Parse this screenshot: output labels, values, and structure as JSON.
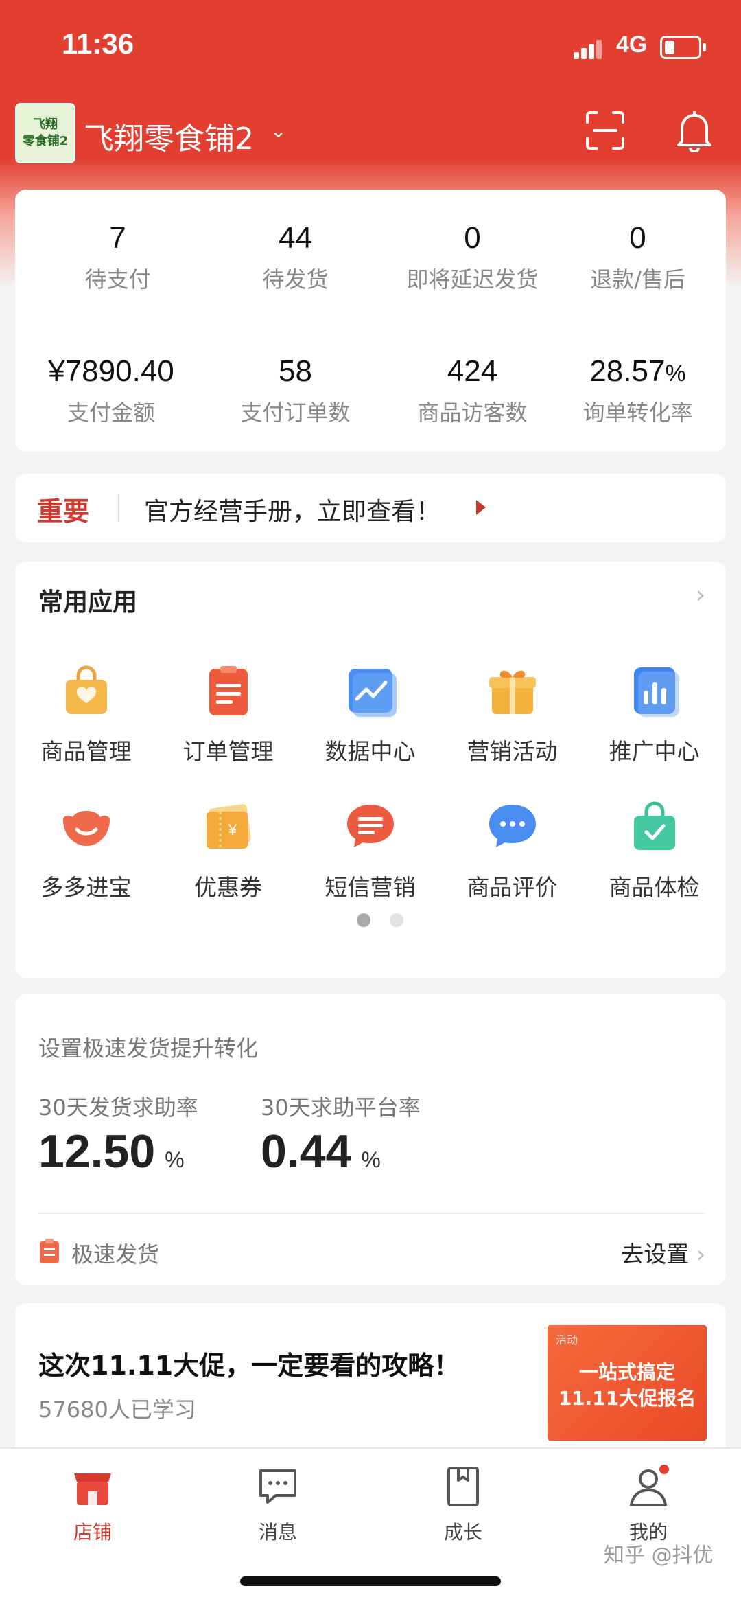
{
  "status_bar": {
    "time": "11:36",
    "network": "4G"
  },
  "shop": {
    "logo_text": "飞翔\n零食铺2",
    "name": "飞翔零食铺2"
  },
  "stats_top": [
    {
      "value": "7",
      "label": "待支付"
    },
    {
      "value": "44",
      "label": "待发货"
    },
    {
      "value": "0",
      "label": "即将延迟发货"
    },
    {
      "value": "0",
      "label": "退款/售后"
    }
  ],
  "stats_bottom": [
    {
      "value": "¥7890.40",
      "label": "支付金额"
    },
    {
      "value": "58",
      "label": "支付订单数"
    },
    {
      "value": "424",
      "label": "商品访客数"
    },
    {
      "value": "28.57",
      "unit": "%",
      "label": "询单转化率"
    }
  ],
  "notice": {
    "tag": "重要",
    "text": "官方经营手册，立即查看！"
  },
  "apps": {
    "title": "常用应用",
    "items": [
      {
        "label": "商品管理",
        "icon": "shopping-bag-icon"
      },
      {
        "label": "订单管理",
        "icon": "clipboard-icon"
      },
      {
        "label": "数据中心",
        "icon": "chart-line-icon"
      },
      {
        "label": "营销活动",
        "icon": "gift-box-icon"
      },
      {
        "label": "推广中心",
        "icon": "bar-chart-icon"
      },
      {
        "label": "多多进宝",
        "icon": "ingot-icon"
      },
      {
        "label": "优惠券",
        "icon": "coupon-icon"
      },
      {
        "label": "短信营销",
        "icon": "sms-icon"
      },
      {
        "label": "商品评价",
        "icon": "comment-icon"
      },
      {
        "label": "商品体检",
        "icon": "check-bag-icon"
      }
    ]
  },
  "shipping": {
    "title": "设置极速发货提升转化",
    "metric1_label": "30天发货求助率",
    "metric1_value": "12.50",
    "metric2_label": "30天求助平台率",
    "metric2_value": "0.44",
    "unit": "%",
    "fast_label": "极速发货",
    "go_label": "去设置"
  },
  "promo": {
    "title": "这次11.11大促，一定要看的攻略！",
    "subtitle": "57680人已学习",
    "banner_tag": "活动",
    "banner_line1": "一站式搞定",
    "banner_line2": "11.11大促报名"
  },
  "tabs": [
    {
      "label": "店铺",
      "icon": "store-icon"
    },
    {
      "label": "消息",
      "icon": "message-icon"
    },
    {
      "label": "成长",
      "icon": "book-icon"
    },
    {
      "label": "我的",
      "icon": "user-icon"
    }
  ],
  "watermark": "知乎 @抖优",
  "colors": {
    "brand_red": "#e23f30",
    "accent_red": "#d03a2e"
  }
}
